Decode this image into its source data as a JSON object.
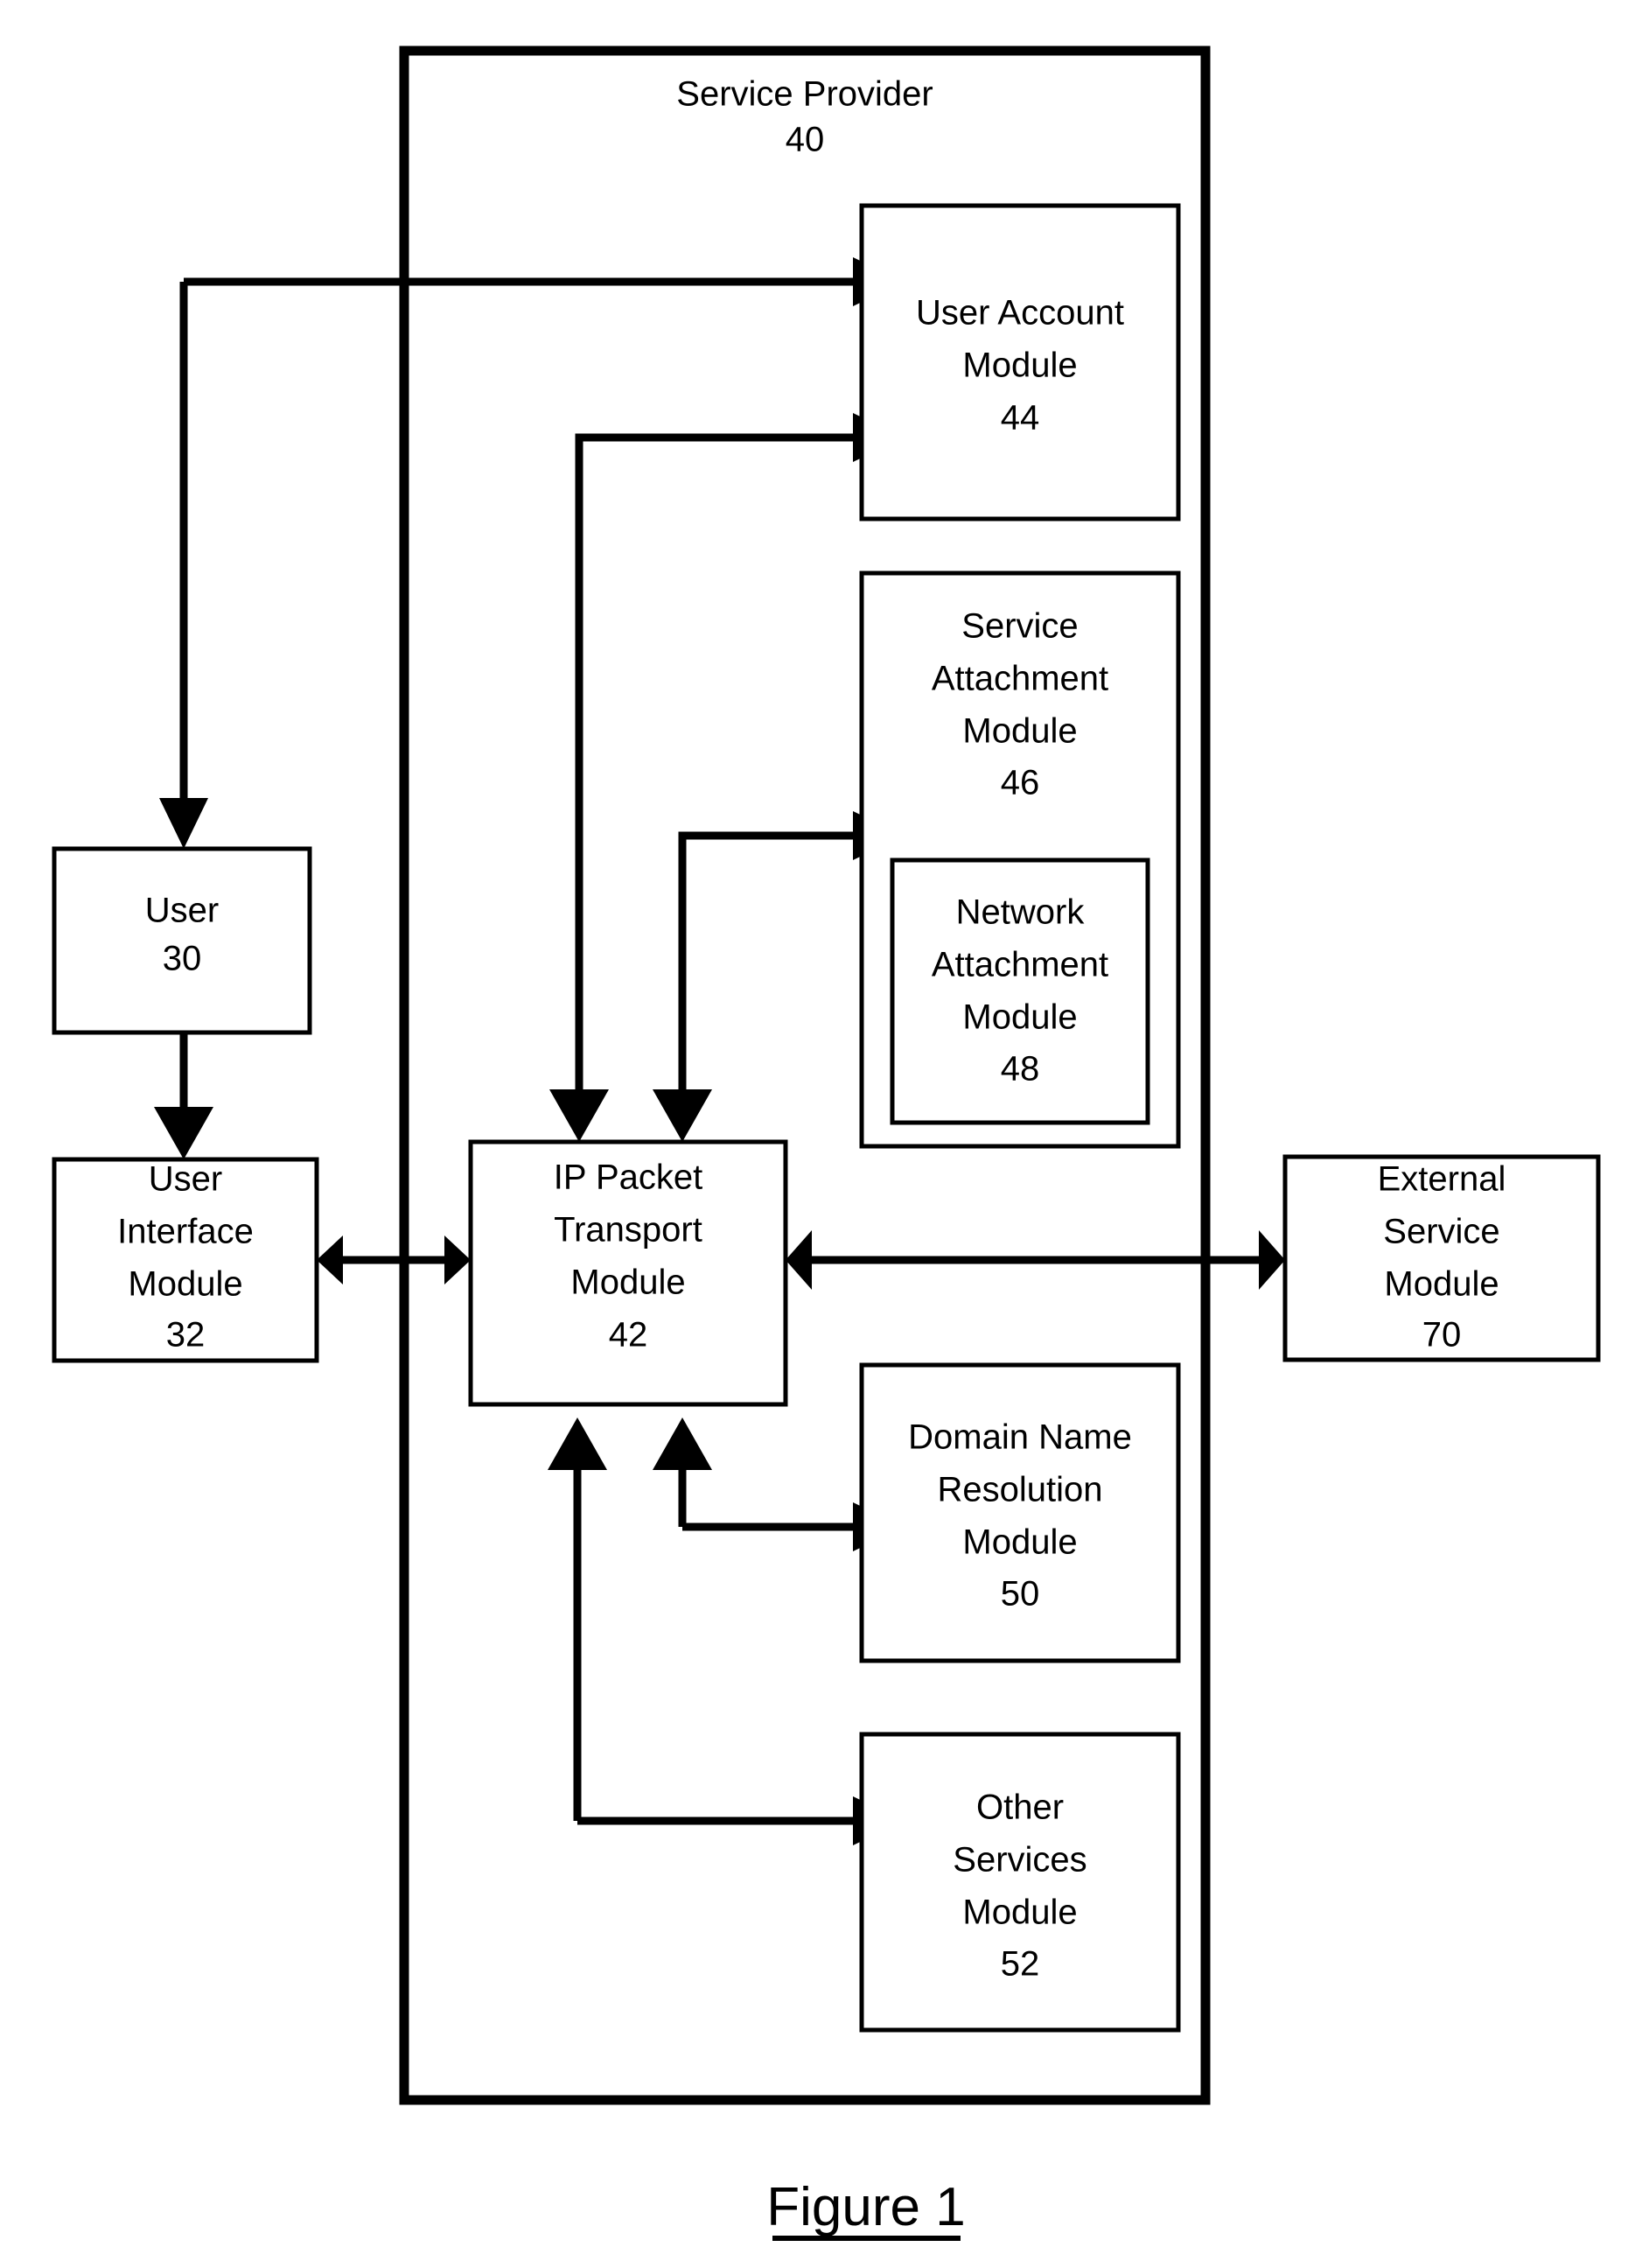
{
  "figure": {
    "caption": "Figure 1",
    "container": {
      "title": "Service Provider",
      "ref": "40"
    },
    "boxes": [
      {
        "id": "user",
        "lines": [
          "User",
          "30"
        ]
      },
      {
        "id": "user_interface_module",
        "lines": [
          "User",
          "Interface",
          "Module",
          "32"
        ]
      },
      {
        "id": "ip_packet_transport_module",
        "lines": [
          "IP Packet",
          "Transport",
          "Module",
          "42"
        ]
      },
      {
        "id": "user_account_module",
        "lines": [
          "User Account",
          "Module",
          "44"
        ]
      },
      {
        "id": "service_attachment_module",
        "lines": [
          "Service",
          "Attachment",
          "Module",
          "46"
        ]
      },
      {
        "id": "network_attachment_module",
        "lines": [
          "Network",
          "Attachment",
          "Module",
          "48"
        ]
      },
      {
        "id": "domain_name_resolution_module",
        "lines": [
          "Domain Name",
          "Resolution",
          "Module",
          "50"
        ]
      },
      {
        "id": "other_services_module",
        "lines": [
          "Other",
          "Services",
          "Module",
          "52"
        ]
      },
      {
        "id": "external_service_module",
        "lines": [
          "External",
          "Service",
          "Module",
          "70"
        ]
      }
    ],
    "connections": [
      {
        "from": "user_account_module",
        "to": "user",
        "type": "single"
      },
      {
        "from": "user",
        "to": "user_interface_module",
        "type": "single"
      },
      {
        "from": "user_interface_module",
        "to": "ip_packet_transport_module",
        "type": "double"
      },
      {
        "from": "ip_packet_transport_module",
        "to": "user_account_module",
        "type": "single"
      },
      {
        "from": "ip_packet_transport_module",
        "to": "service_attachment_module",
        "type": "single"
      },
      {
        "from": "domain_name_resolution_module",
        "to": "ip_packet_transport_module",
        "type": "single"
      },
      {
        "from": "other_services_module",
        "to": "ip_packet_transport_module",
        "type": "single"
      },
      {
        "from": "ip_packet_transport_module",
        "to": "external_service_module",
        "type": "double"
      }
    ],
    "colors": {
      "line": "#000000",
      "background": "#ffffff"
    }
  }
}
